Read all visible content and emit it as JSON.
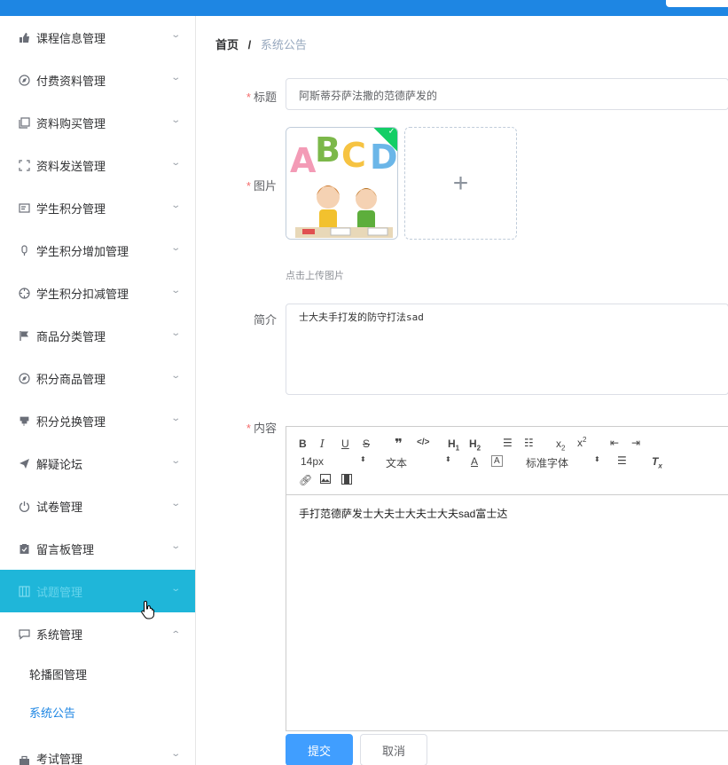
{
  "sidebar": {
    "items": [
      {
        "label": "课程信息管理",
        "icon": "thumbs-up-icon",
        "glyph": "👍"
      },
      {
        "label": "付费资料管理",
        "icon": "compass-icon",
        "glyph": "◎"
      },
      {
        "label": "资料购买管理",
        "icon": "copy-icon",
        "glyph": "❐"
      },
      {
        "label": "资料发送管理",
        "icon": "fullscreen-icon",
        "glyph": "⛶"
      },
      {
        "label": "学生积分管理",
        "icon": "postcard-icon",
        "glyph": "▤"
      },
      {
        "label": "学生积分增加管理",
        "icon": "mic-icon",
        "glyph": "▮"
      },
      {
        "label": "学生积分扣减管理",
        "icon": "aim-icon",
        "glyph": "⊕"
      },
      {
        "label": "商品分类管理",
        "icon": "flag-icon",
        "glyph": "⚑"
      },
      {
        "label": "积分商品管理",
        "icon": "compass-icon",
        "glyph": "◎"
      },
      {
        "label": "积分兑换管理",
        "icon": "stamp-icon",
        "glyph": "⚲"
      },
      {
        "label": "解疑论坛",
        "icon": "send-icon",
        "glyph": "➤"
      },
      {
        "label": "试卷管理",
        "icon": "power-icon",
        "glyph": "⏻"
      },
      {
        "label": "留言板管理",
        "icon": "checklist-icon",
        "glyph": "☑"
      },
      {
        "label": "试题管理",
        "icon": "grid-icon",
        "glyph": "▦"
      },
      {
        "label": "系统管理",
        "icon": "chat-icon",
        "glyph": "▭"
      }
    ],
    "sub_items": [
      {
        "label": "轮播图管理"
      },
      {
        "label": "系统公告"
      }
    ],
    "last_item": {
      "label": "考试管理",
      "icon": "suitcase-icon",
      "glyph": "▬"
    }
  },
  "breadcrumb": {
    "home": "首页",
    "separator": "/",
    "current": "系统公告"
  },
  "form": {
    "title_label": "标题",
    "title_value": "阿斯蒂芬萨法撒的范德萨发的",
    "image_label": "图片",
    "upload_tip": "点击上传图片",
    "add_glyph": "+",
    "intro_label": "简介",
    "intro_value": "士大夫手打发的防守打法sad",
    "content_label": "内容",
    "required_mark": "*"
  },
  "editor": {
    "font_size": "14px",
    "header_select": "文本",
    "font_family": "标准字体",
    "content": "手打范德萨发士大夫士大夫士大夫sad富士达"
  },
  "actions": {
    "submit_label": "提交",
    "cancel_label": "取消"
  },
  "colors": {
    "topbar": "#1e86e3",
    "active_menu": "#1fb6d9",
    "primary": "#409eff",
    "required": "#f56c6c"
  }
}
